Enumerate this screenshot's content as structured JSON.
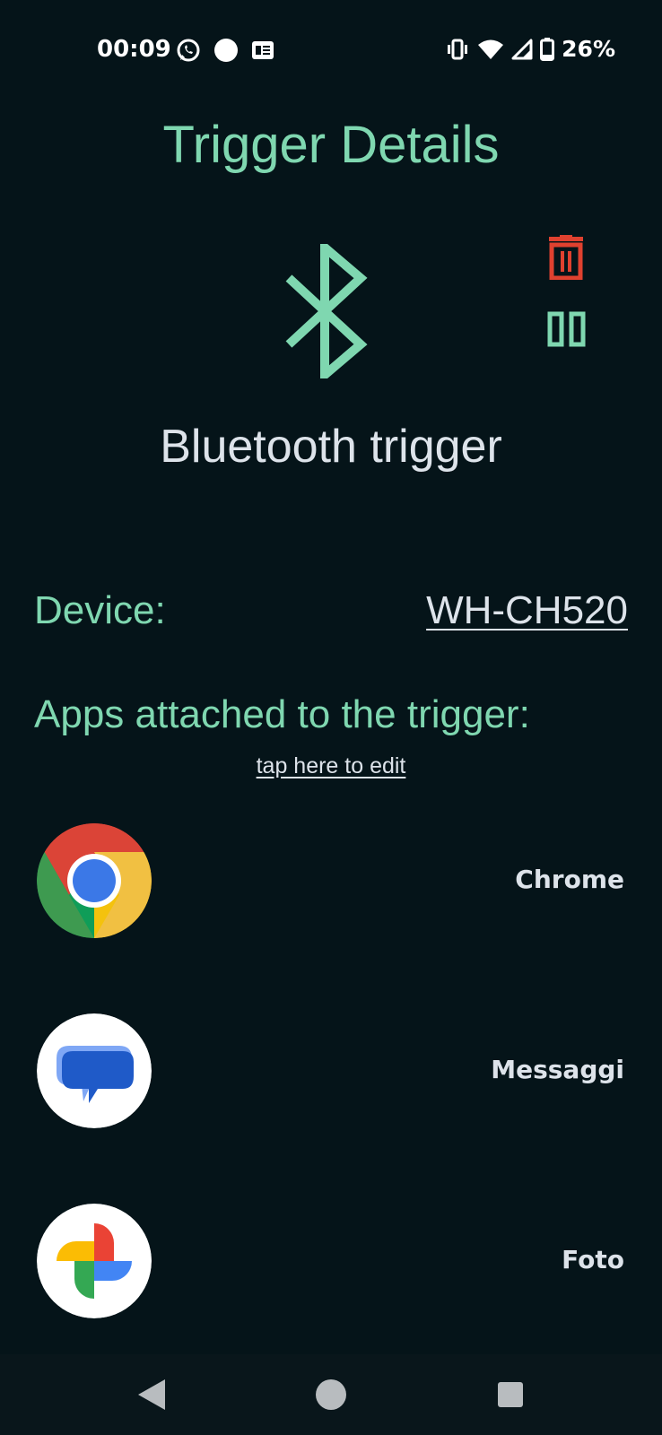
{
  "status_bar": {
    "time": "00:09",
    "battery": "26%",
    "icons_left": [
      "whatsapp-icon",
      "dot-icon",
      "news-icon"
    ],
    "icons_right": [
      "vibrate-icon",
      "wifi-icon",
      "signal-icon",
      "battery-icon"
    ]
  },
  "header": {
    "title": "Trigger Details"
  },
  "trigger": {
    "icon": "bluetooth-icon",
    "name": "Bluetooth trigger",
    "actions": [
      "delete-icon",
      "pause-icon"
    ]
  },
  "device": {
    "label": "Device:",
    "value": "WH-CH520"
  },
  "apps": {
    "heading": "Apps attached to the trigger:",
    "edit_link": "tap here to edit",
    "items": [
      {
        "name": "Chrome",
        "icon": "chrome-icon"
      },
      {
        "name": "Messaggi",
        "icon": "messages-icon"
      },
      {
        "name": "Foto",
        "icon": "photos-icon"
      }
    ]
  },
  "nav_bar": {
    "buttons": [
      "back-icon",
      "home-icon",
      "recents-icon"
    ]
  },
  "colors": {
    "background": "#051419",
    "accent": "#7fd7b0",
    "danger": "#e0412f",
    "text": "#dde3ea"
  }
}
